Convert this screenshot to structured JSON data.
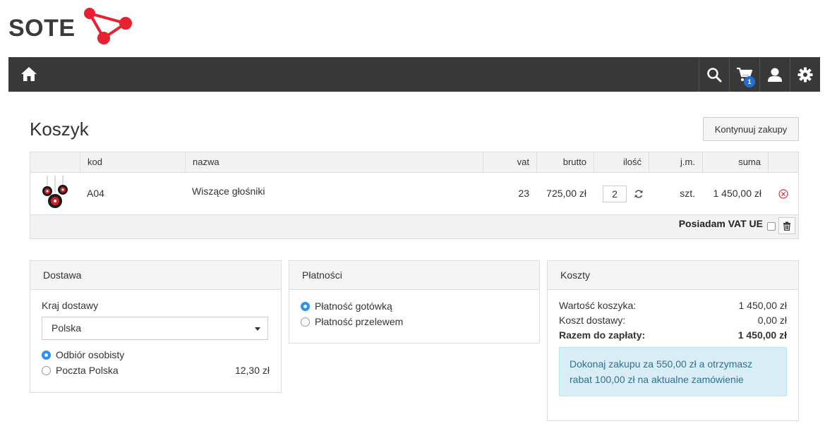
{
  "logo": {
    "text": "SOTE"
  },
  "navbar": {
    "icons": [
      "home-icon",
      "search-icon",
      "cart-icon",
      "user-icon",
      "gear-icon"
    ],
    "cart_count": "1"
  },
  "page": {
    "title": "Koszyk",
    "continue_label": "Kontynuuj zakupy"
  },
  "table": {
    "headers": {
      "kod": "kod",
      "nazwa": "nazwa",
      "vat": "vat",
      "brutto": "brutto",
      "ilosc": "ilość",
      "jm": "j.m.",
      "suma": "suma"
    },
    "rows": [
      {
        "kod": "A04",
        "nazwa": "Wiszące głośniki",
        "vat": "23",
        "brutto": "725,00 zł",
        "ilosc": "2",
        "jm": "szt.",
        "suma": "1 450,00 zł"
      }
    ],
    "vat_ue_label": "Posiadam VAT UE"
  },
  "delivery": {
    "title": "Dostawa",
    "country_label": "Kraj dostawy",
    "country_value": "Polska",
    "options": [
      {
        "label": "Odbiór osobisty",
        "price": "",
        "checked": true
      },
      {
        "label": "Poczta Polska",
        "price": "12,30 zł",
        "checked": false
      }
    ]
  },
  "payment": {
    "title": "Płatności",
    "options": [
      {
        "label": "Płatność gotówką",
        "checked": true
      },
      {
        "label": "Płatność przelewem",
        "checked": false
      }
    ]
  },
  "costs": {
    "title": "Koszty",
    "rows": [
      {
        "label": "Wartość koszyka:",
        "value": "1 450,00 zł"
      },
      {
        "label": "Koszt dostawy:",
        "value": "0,00 zł"
      },
      {
        "label": "Razem do zapłaty:",
        "value": "1 450,00 zł"
      }
    ],
    "promo": "Dokonaj zakupu za 550,00 zł a otrzymasz rabat 100,00 zł na aktualne zamówienie"
  },
  "colors": {
    "navbar": "#393939",
    "logo_red": "#e8202f",
    "badge": "#1f6fd6",
    "radio": "#2f8ff7",
    "promo_bg": "#d9edf7"
  }
}
